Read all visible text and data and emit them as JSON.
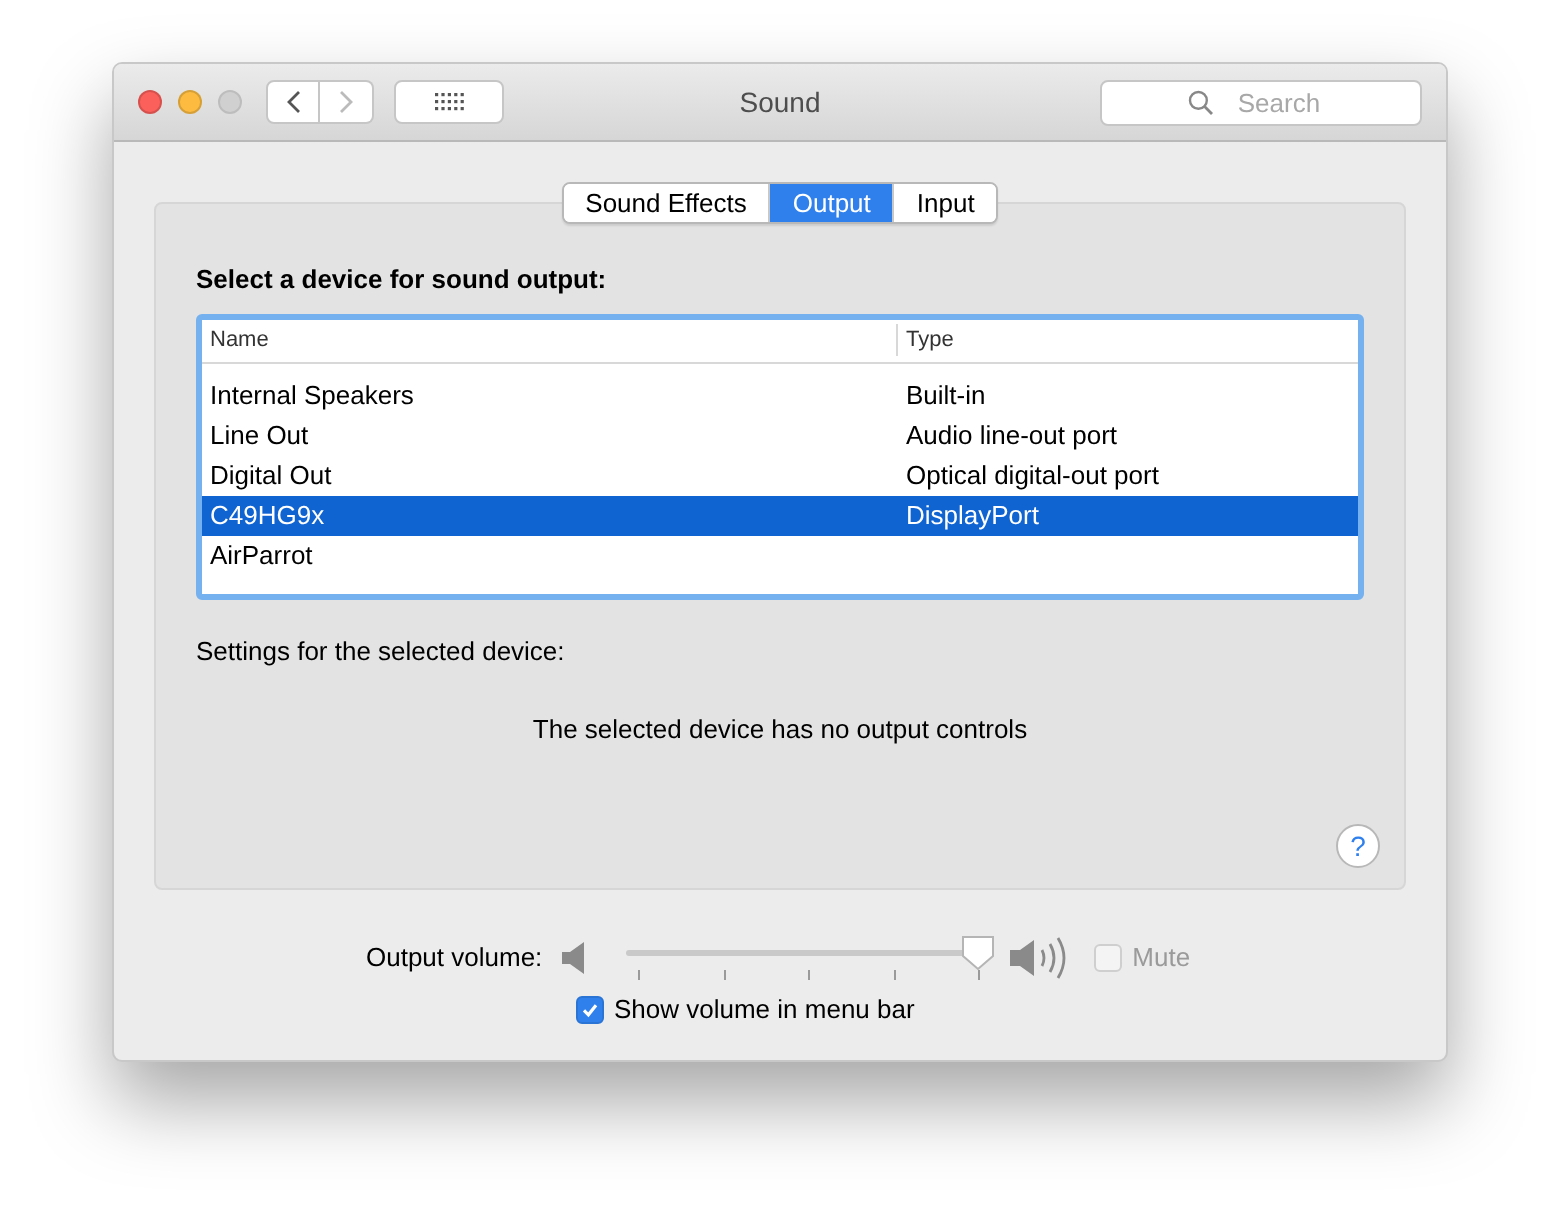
{
  "window": {
    "title": "Sound",
    "close_enabled": true,
    "minimize_enabled": true,
    "zoom_enabled": false,
    "back_enabled": true,
    "forward_enabled": false
  },
  "search": {
    "placeholder": "Search"
  },
  "tabs": [
    {
      "label": "Sound Effects",
      "selected": false
    },
    {
      "label": "Output",
      "selected": true
    },
    {
      "label": "Input",
      "selected": false
    }
  ],
  "device_list": {
    "heading": "Select a device for sound output:",
    "columns": [
      "Name",
      "Type"
    ],
    "rows": [
      {
        "name": "Internal Speakers",
        "type": "Built-in",
        "selected": false
      },
      {
        "name": "Line Out",
        "type": "Audio line-out port",
        "selected": false
      },
      {
        "name": "Digital Out",
        "type": "Optical digital-out port",
        "selected": false
      },
      {
        "name": "C49HG9x",
        "type": "DisplayPort",
        "selected": true
      },
      {
        "name": "AirParrot",
        "selected": false
      }
    ]
  },
  "settings_label": "Settings for the selected device:",
  "no_controls_message": "The selected device has no output controls",
  "help": "?",
  "volume": {
    "label": "Output volume:",
    "level": 1.0,
    "mute": {
      "label": "Mute",
      "checked": false,
      "disabled": true
    }
  },
  "show_in_menu_bar": {
    "label": "Show volume in menu bar",
    "checked": true
  }
}
